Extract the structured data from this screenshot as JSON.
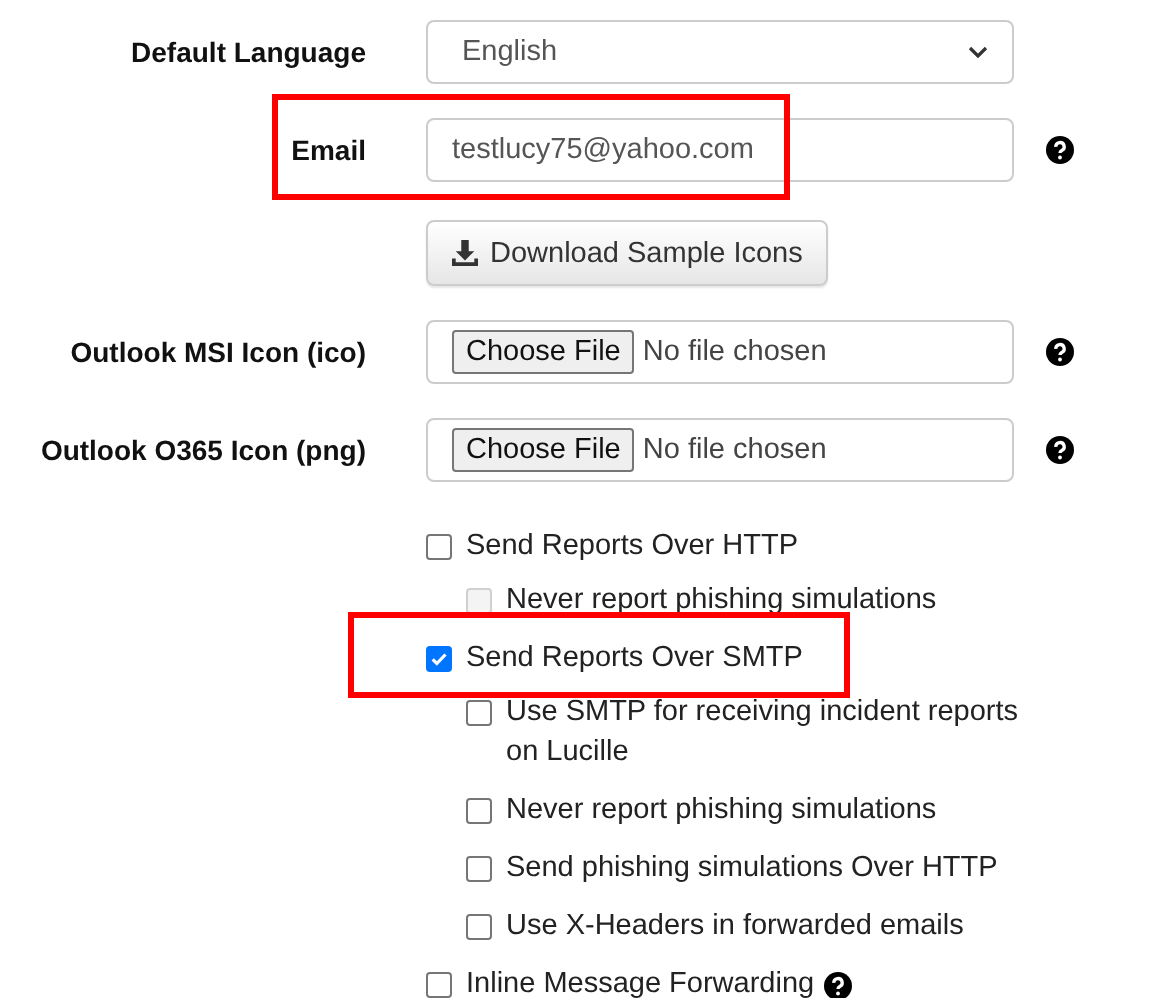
{
  "fields": [
    {
      "kind": "select",
      "label": "Default Language",
      "value": "English"
    },
    {
      "kind": "text",
      "label": "Email",
      "value": "testlucy75@yahoo.com",
      "help": true,
      "highlight": true
    },
    {
      "kind": "button",
      "value": "Download Sample Icons"
    },
    {
      "kind": "file",
      "label": "Outlook MSI Icon (ico)",
      "button": "Choose File",
      "value": "No file chosen",
      "help": true
    },
    {
      "kind": "file",
      "label": "Outlook O365 Icon (png)",
      "button": "Choose File",
      "value": "No file chosen",
      "help": true
    }
  ],
  "options": [
    {
      "label": "Send Reports Over HTTP",
      "checked": false,
      "disabled": false,
      "children": [
        {
          "label": "Never report phishing simulations",
          "checked": false,
          "disabled": true
        }
      ]
    },
    {
      "label": "Send Reports Over SMTP",
      "checked": true,
      "disabled": false,
      "highlight": true,
      "children": [
        {
          "label": "Use SMTP for receiving incident reports on Lucille",
          "checked": false,
          "disabled": false
        },
        {
          "label": "Never report phishing simulations",
          "checked": false,
          "disabled": false
        },
        {
          "label": "Send phishing simulations Over HTTP",
          "checked": false,
          "disabled": false
        },
        {
          "label": "Use X-Headers in forwarded emails",
          "checked": false,
          "disabled": false
        }
      ]
    },
    {
      "label": "Inline Message Forwarding",
      "checked": false,
      "disabled": false,
      "help": true
    }
  ]
}
